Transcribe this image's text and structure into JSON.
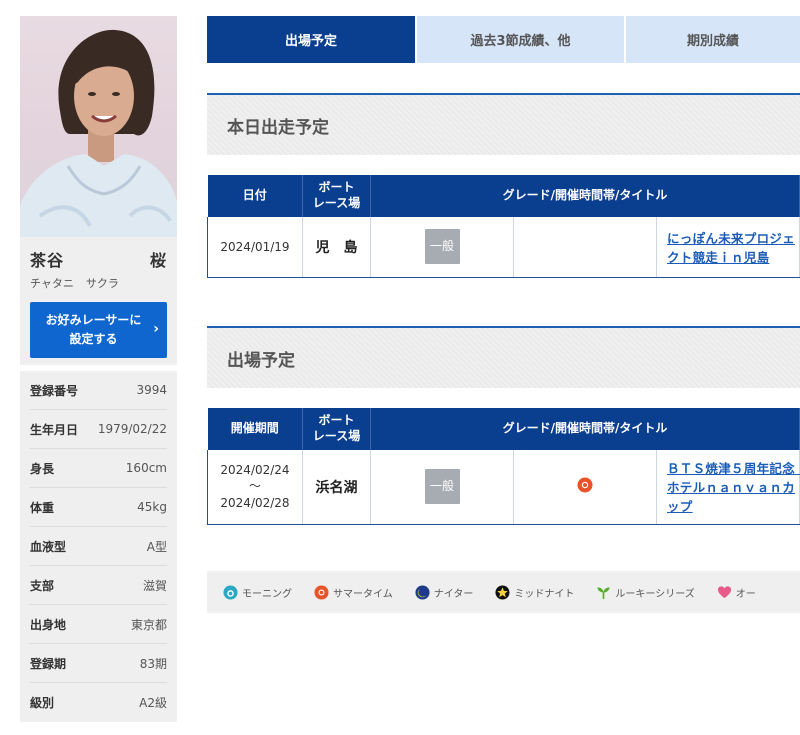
{
  "racer": {
    "name_family": "茶谷",
    "name_given": "桜",
    "kana_family": "チャタニ",
    "kana_given": "サクラ",
    "favorite_button": "お好みレーサーに\n設定する",
    "info": [
      {
        "label": "登録番号",
        "value": "3994"
      },
      {
        "label": "生年月日",
        "value": "1979/02/22"
      },
      {
        "label": "身長",
        "value": "160cm"
      },
      {
        "label": "体重",
        "value": "45kg"
      },
      {
        "label": "血液型",
        "value": "A型"
      },
      {
        "label": "支部",
        "value": "滋賀"
      },
      {
        "label": "出身地",
        "value": "東京都"
      },
      {
        "label": "登録期",
        "value": "83期"
      },
      {
        "label": "級別",
        "value": "A2級"
      }
    ]
  },
  "tabs": [
    {
      "label": "出場予定"
    },
    {
      "label": "過去3節成績、他"
    },
    {
      "label": "期別成績"
    }
  ],
  "today": {
    "heading": "本日出走予定",
    "columns": [
      "日付",
      "ボート\nレース場",
      "グレード/開催時間帯/タイトル"
    ],
    "rows": [
      {
        "date": "2024/01/19",
        "venue": "児　島",
        "grade": "一般",
        "title": "にっぽん未来プロジェクト競走ｉｎ児島"
      }
    ]
  },
  "upcoming": {
    "heading": "出場予定",
    "columns": [
      "開催期間",
      "ボート\nレース場",
      "グレード/開催時間帯/タイトル"
    ],
    "rows": [
      {
        "date_start": "2024/02/24",
        "tilde": "～",
        "date_end": "2024/02/28",
        "venue": "浜名湖",
        "grade": "一般",
        "time_icon": "summer-time-icon",
        "title": "ＢＴＳ焼津５周年記念　ホテルｎａｎｖａｎカップ"
      }
    ]
  },
  "legend": [
    {
      "icon": "morning-icon",
      "label": "モーニング",
      "color": "#2aa8c4"
    },
    {
      "icon": "summer-time-icon",
      "label": "サマータイム",
      "color": "#e8542a"
    },
    {
      "icon": "nighter-icon",
      "label": "ナイター",
      "color": "#1e3a8a"
    },
    {
      "icon": "midnight-icon",
      "label": "ミッドナイト",
      "color": "#111111"
    },
    {
      "icon": "rookie-icon",
      "label": "ルーキーシリーズ",
      "color": "#5aab2e"
    },
    {
      "icon": "heart-icon",
      "label": "オー",
      "color": "#e85a8a"
    }
  ],
  "colors": {
    "tab_active": "#0a3e8f",
    "tab_inactive": "#d6e5f8",
    "button_blue": "#0f66cf",
    "link": "#1a5cb8"
  }
}
